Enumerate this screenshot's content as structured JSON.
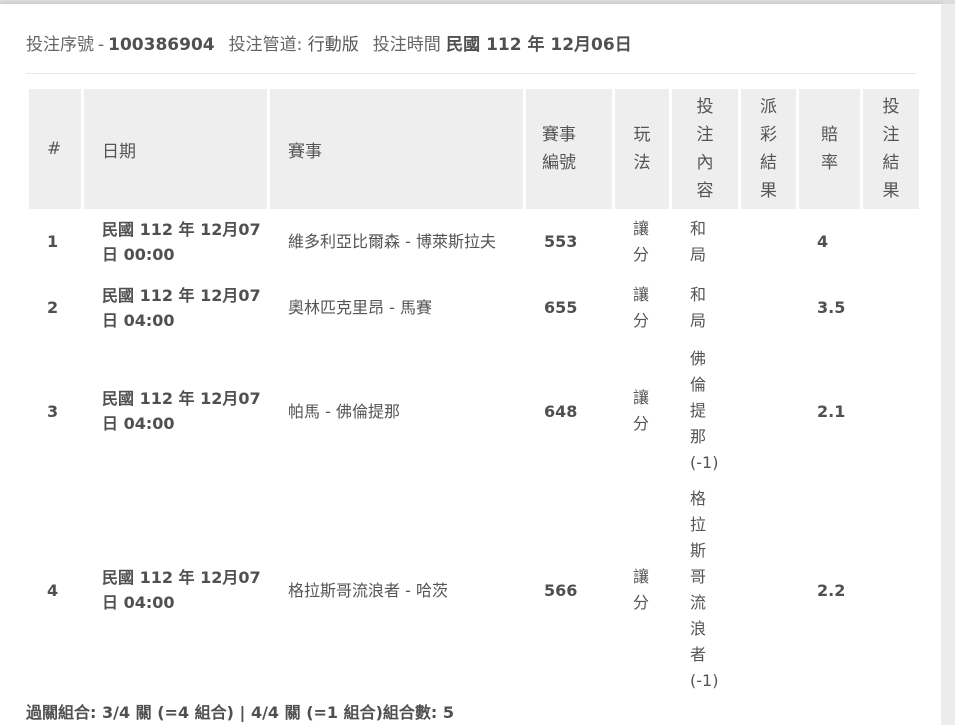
{
  "meta": {
    "serial_label": "投注序號",
    "serial_sep": "-",
    "serial_value": "100386904",
    "channel_label": "投注管道:",
    "channel_value": "行動版",
    "time_label": "投注時間",
    "time_value": "民國 112 年 12月06日"
  },
  "table": {
    "headers": {
      "index": "#",
      "date": "日期",
      "match": "賽事",
      "match_no": "賽事編號",
      "play": "玩法",
      "content": "投注內容",
      "draw_result": "派彩結果",
      "odds": "賠率",
      "bet_result": "投注結果"
    },
    "rows": [
      {
        "index": "1",
        "date": "民國 112 年 12月07日 00:00",
        "match": "維多利亞比爾森 - 博萊斯拉夫",
        "match_no": "553",
        "play": "讓分",
        "content": "和局",
        "draw_result": "",
        "odds": "4",
        "bet_result": ""
      },
      {
        "index": "2",
        "date": "民國 112 年 12月07日 04:00",
        "match": "奧林匹克里昂 - 馬賽",
        "match_no": "655",
        "play": "讓分",
        "content": "和局",
        "draw_result": "",
        "odds": "3.5",
        "bet_result": ""
      },
      {
        "index": "3",
        "date": "民國 112 年 12月07日 04:00",
        "match": "帕馬 - 佛倫提那",
        "match_no": "648",
        "play": "讓分",
        "content": "佛倫提那(-1)",
        "draw_result": "",
        "odds": "2.1",
        "bet_result": ""
      },
      {
        "index": "4",
        "date": "民國 112 年 12月07日 04:00",
        "match": "格拉斯哥流浪者 - 哈茨",
        "match_no": "566",
        "play": "讓分",
        "content": "格拉斯哥流浪者(-1)",
        "draw_result": "",
        "odds": "2.2",
        "bet_result": ""
      }
    ]
  },
  "footer": {
    "summary": "過關組合: 3/4 關 (=4 組合) | 4/4 關 (=1 組合)組合數: 5"
  }
}
